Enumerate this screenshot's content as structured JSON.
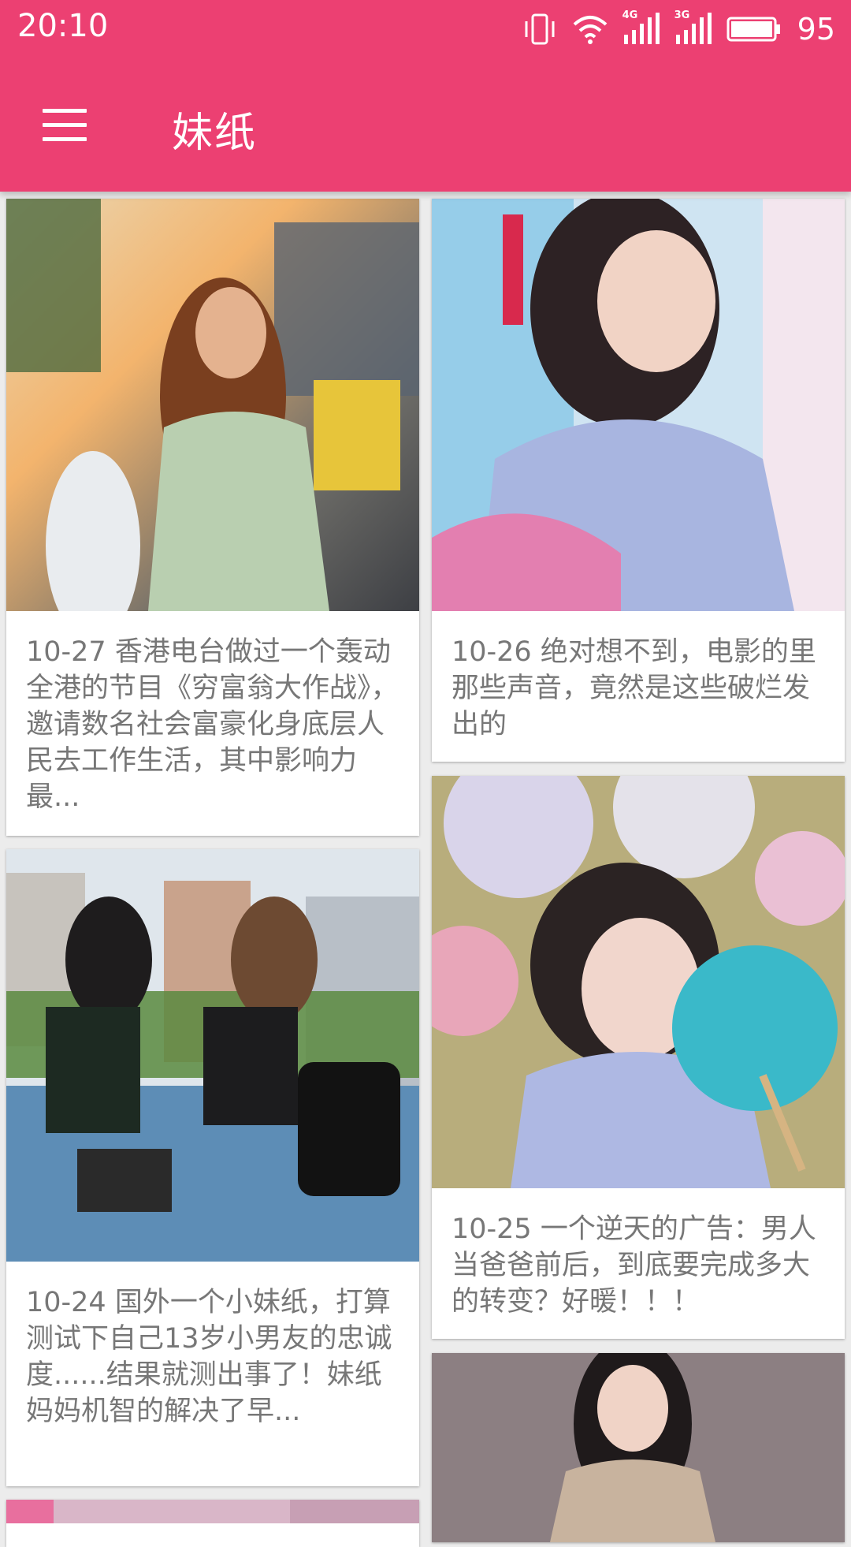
{
  "status_bar": {
    "time": "20:10",
    "battery": "95",
    "net1": "4G",
    "net2": "3G"
  },
  "toolbar": {
    "title": "妹纸"
  },
  "feed": [
    {
      "caption": "10-27 香港电台做过一个轰动全港的节目《穷富翁大作战》，邀请数名社会富豪化身底层人民去工作生活，其中影响力最..."
    },
    {
      "caption": "10-26 绝对想不到，电影的里那些声音，竟然是这些破烂发出的"
    },
    {
      "caption": "10-24 国外一个小妹纸，打算测试下自己13岁小男友的忠诚度......结果就测出事了！妹纸妈妈机智的解决了早..."
    },
    {
      "caption": "10-25 一个逆天的广告：男人当爸爸前后，到底要完成多大的转变？好暖！！！"
    }
  ],
  "colors": {
    "primary": "#ec4072",
    "caption_text": "#777777",
    "background": "#ececec"
  }
}
